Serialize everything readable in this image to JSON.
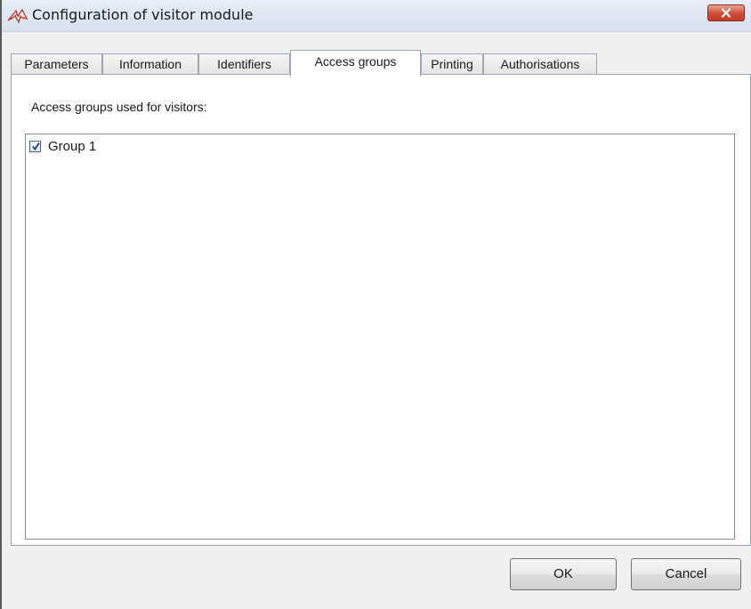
{
  "window": {
    "title": "Configuration of visitor module",
    "icon": "app-logo-icon",
    "close_icon": "close-icon"
  },
  "tabs": [
    {
      "label": "Parameters",
      "active": false
    },
    {
      "label": "Information",
      "active": false
    },
    {
      "label": "Identifiers",
      "active": false
    },
    {
      "label": "Access groups",
      "active": true
    },
    {
      "label": "Printing",
      "active": false
    },
    {
      "label": "Authorisations",
      "active": false
    }
  ],
  "access_groups": {
    "label": "Access groups used for visitors:",
    "items": [
      {
        "label": "Group 1",
        "checked": true
      }
    ]
  },
  "buttons": {
    "ok": "OK",
    "cancel": "Cancel"
  },
  "colors": {
    "close_button": "#cf4d35",
    "title_bar": "#dbe5f1",
    "logo": "#c0392b"
  }
}
